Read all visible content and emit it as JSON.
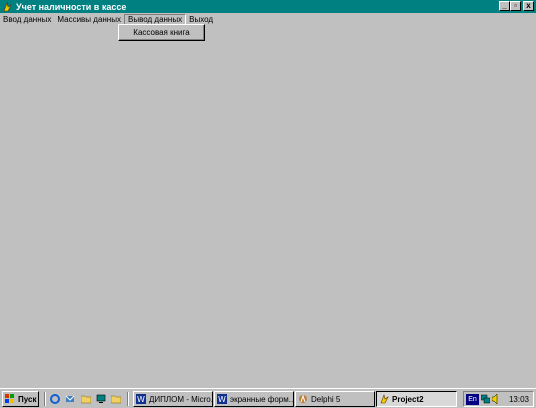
{
  "window": {
    "title": "Учет наличности в кассе",
    "buttons": {
      "minimize": "_",
      "maximize": "▫",
      "close": "x"
    }
  },
  "menu": {
    "items": [
      "Ввод данных",
      "Массивы данных",
      "Вывод данных",
      "Выход"
    ],
    "active_index": 2,
    "dropdown": [
      "Кассовая книга"
    ]
  },
  "taskbar": {
    "start": "Пуск",
    "tasks": [
      "ДИПЛОМ - Micro...",
      "экранные форм...",
      "Delphi 5",
      "Project2"
    ],
    "active_task": "Project2",
    "tray": {
      "language": "En",
      "clock": "13:03"
    }
  },
  "colors": {
    "title_bar": "#008080",
    "surface": "#c0c0c0"
  }
}
